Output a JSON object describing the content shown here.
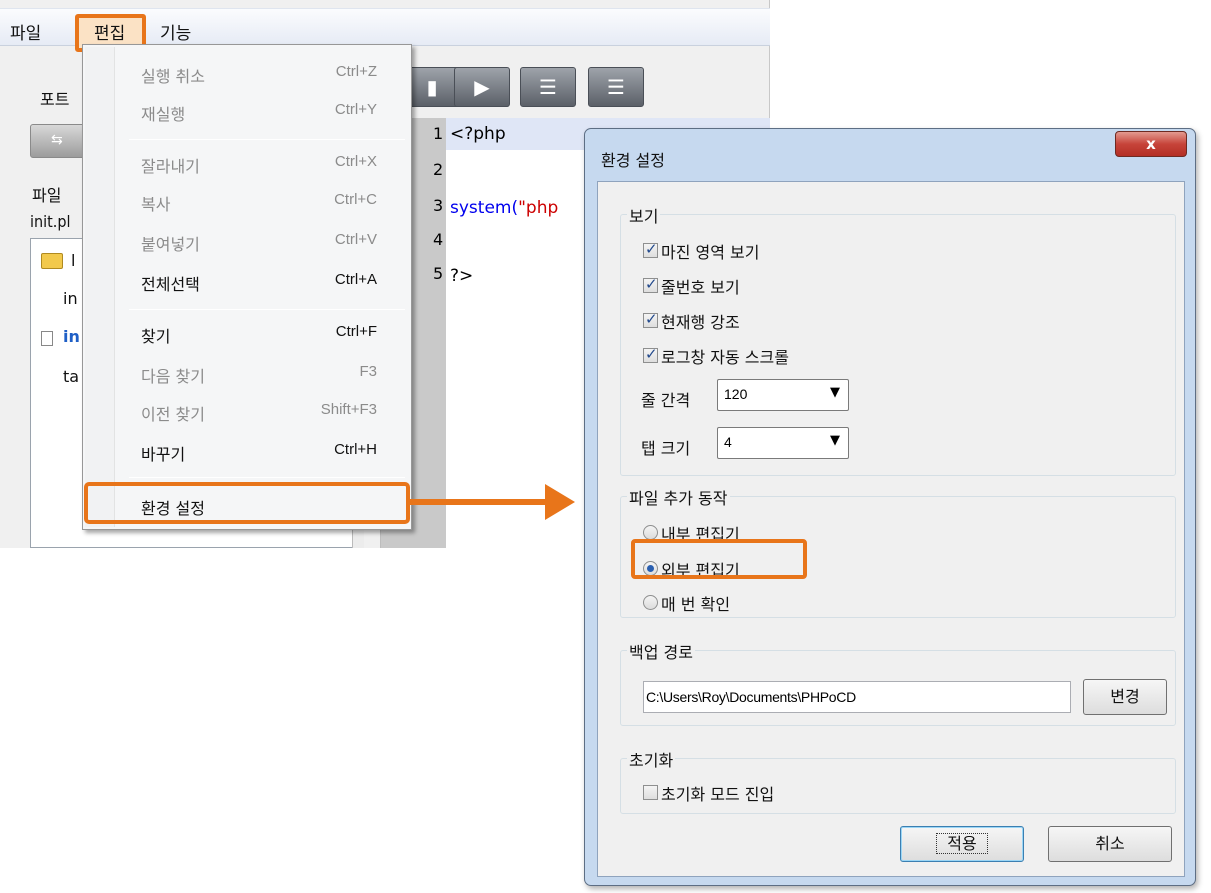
{
  "menubar": {
    "file": "파일",
    "edit": "편집",
    "function": "기능"
  },
  "left_panel": {
    "port_label": "포트",
    "file_label": "파일",
    "file_name": "init.pl",
    "tree_folder": "l",
    "tree_row1": "in",
    "tree_row2": "in",
    "tree_row3": "ta"
  },
  "toolbar": {
    "icons": [
      "stop-icon",
      "play-icon",
      "step-into-icon",
      "step-out-icon"
    ]
  },
  "editor": {
    "line_numbers": [
      "1",
      "2",
      "3",
      "4",
      "5"
    ],
    "line1": "<?php",
    "line3_fn": "system(",
    "line3_str": "\"php",
    "line5": "?>"
  },
  "edit_menu": {
    "items": [
      {
        "label": "실행 취소",
        "shortcut": "Ctrl+Z",
        "enabled": false
      },
      {
        "label": "재실행",
        "shortcut": "Ctrl+Y",
        "enabled": false
      },
      {
        "label": "잘라내기",
        "shortcut": "Ctrl+X",
        "enabled": false
      },
      {
        "label": "복사",
        "shortcut": "Ctrl+C",
        "enabled": false
      },
      {
        "label": "붙여넣기",
        "shortcut": "Ctrl+V",
        "enabled": false
      },
      {
        "label": "전체선택",
        "shortcut": "Ctrl+A",
        "enabled": true
      },
      {
        "label": "찾기",
        "shortcut": "Ctrl+F",
        "enabled": true
      },
      {
        "label": "다음 찾기",
        "shortcut": "F3",
        "enabled": false
      },
      {
        "label": "이전 찾기",
        "shortcut": "Shift+F3",
        "enabled": false
      },
      {
        "label": "바꾸기",
        "shortcut": "Ctrl+H",
        "enabled": true
      },
      {
        "label": "환경 설정",
        "shortcut": "",
        "enabled": true
      }
    ]
  },
  "dialog": {
    "title": "환경 설정",
    "close": "x",
    "view_group": {
      "title": "보기",
      "margin": "마진 영역 보기",
      "line_numbers": "줄번호 보기",
      "highlight_line": "현재행 강조",
      "autoscroll": "로그창 자동 스크롤",
      "line_spacing_label": "줄 간격",
      "line_spacing_value": "120",
      "tab_size_label": "탭 크기",
      "tab_size_value": "4"
    },
    "file_add_group": {
      "title": "파일 추가 동작",
      "internal": "내부 편집기",
      "external": "외부 편집기",
      "ask": "매 번 확인"
    },
    "backup_group": {
      "title": "백업 경로",
      "path": "C:\\Users\\Roy\\Documents\\PHPoCD",
      "change_button": "변경"
    },
    "reset_group": {
      "title": "초기화",
      "enter_reset_mode": "초기화 모드 진입"
    },
    "apply_button": "적용",
    "cancel_button": "취소"
  },
  "colors": {
    "highlight": "#e8751a",
    "dialog_frame": "#c6d9ef"
  }
}
